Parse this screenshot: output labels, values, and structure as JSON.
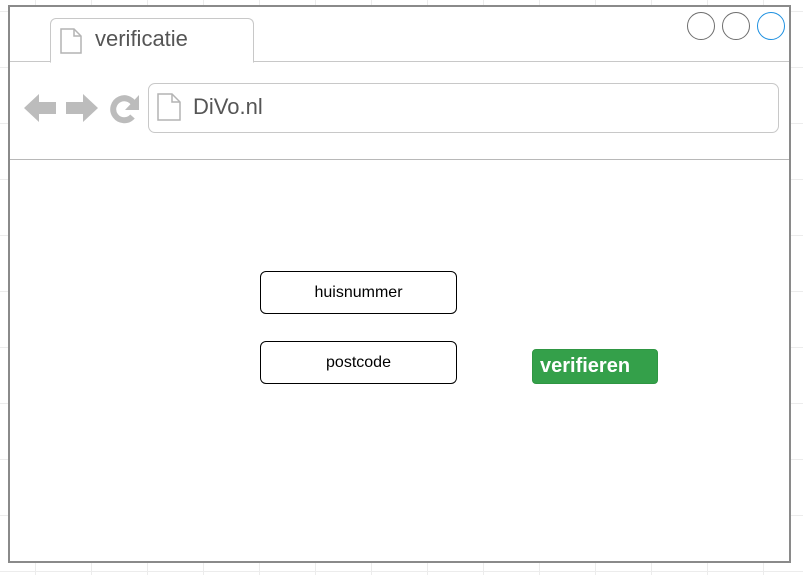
{
  "tab": {
    "title": "verificatie",
    "icon": "document-icon"
  },
  "window_controls": [
    "minimize",
    "maximize",
    "close"
  ],
  "navigation": {
    "back_icon": "arrow-left-icon",
    "forward_icon": "arrow-right-icon",
    "reload_icon": "reload-icon"
  },
  "address_bar": {
    "url": "DiVo.nl",
    "icon": "document-icon"
  },
  "form": {
    "huisnummer_placeholder": "huisnummer",
    "postcode_placeholder": "postcode",
    "submit_label": "verifieren"
  },
  "colors": {
    "accent": "#34a04a",
    "close_control": "#1e90e0",
    "chrome_gray": "#c8c8c8"
  }
}
